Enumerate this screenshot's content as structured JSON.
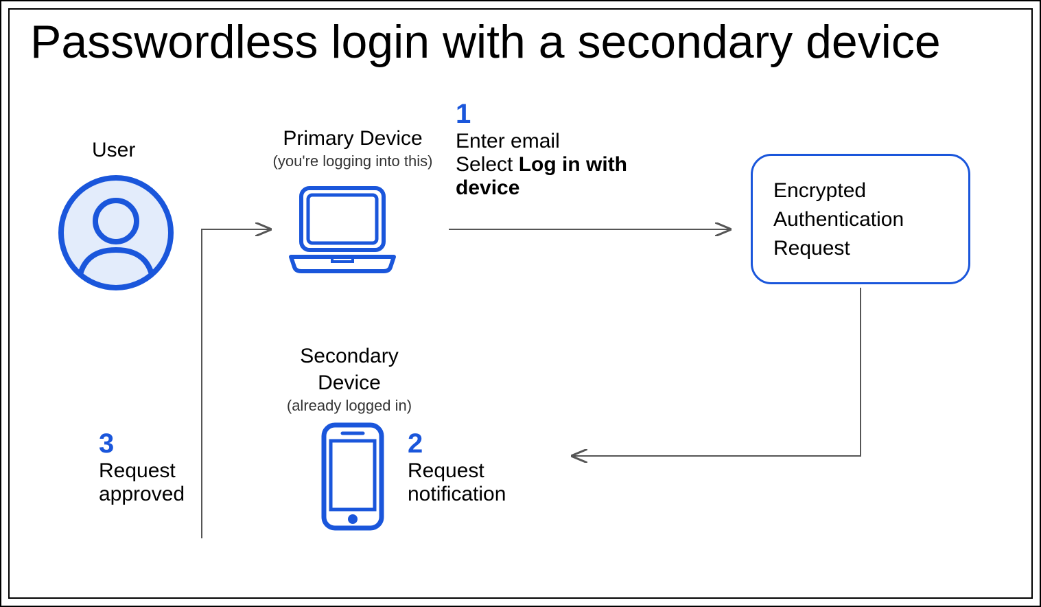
{
  "title": "Passwordless login with a secondary device",
  "user": {
    "label": "User"
  },
  "primary": {
    "label": "Primary Device",
    "sub": "(you're logging into this)"
  },
  "secondary": {
    "label": "Secondary Device",
    "sub": "(already logged in)"
  },
  "steps": {
    "one": {
      "num": "1",
      "line1": "Enter email",
      "line2a": "Select ",
      "line2b": "Log in with device"
    },
    "two": {
      "num": "2",
      "line1": "Request",
      "line2": "notification"
    },
    "three": {
      "num": "3",
      "line1": "Request",
      "line2": "approved"
    }
  },
  "request_box": {
    "line1": "Encrypted",
    "line2": "Authentication",
    "line3": "Request"
  },
  "colors": {
    "accent": "#1A56DB",
    "accent_fill": "#E3ECFB",
    "arrow": "#555555"
  }
}
